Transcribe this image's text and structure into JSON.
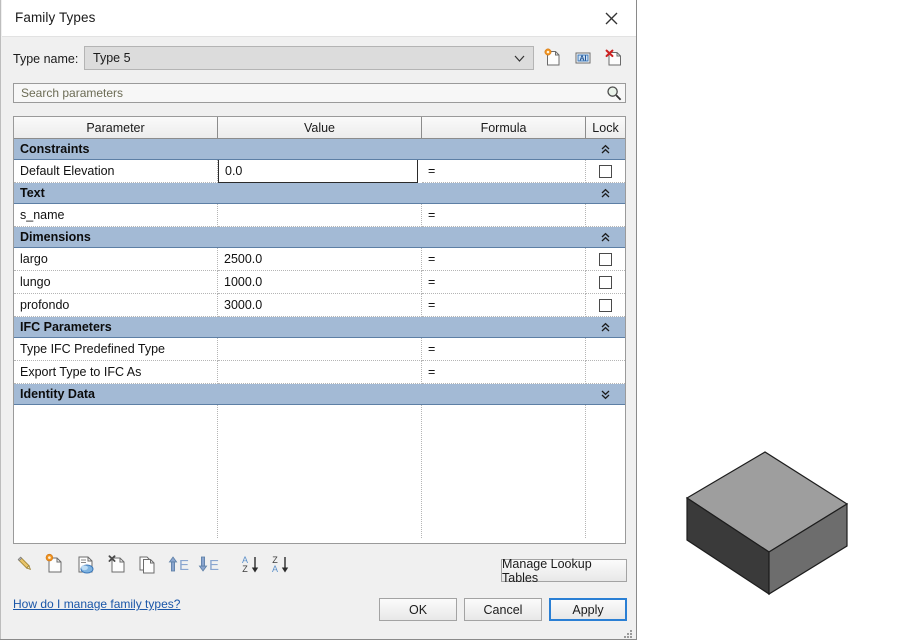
{
  "window": {
    "title": "Family Types",
    "close_icon": "close-icon"
  },
  "type_name": {
    "label": "Type name:",
    "value": "Type 5",
    "dropdown_icon": "chevron-down-icon",
    "buttons": [
      {
        "name": "new-type-icon",
        "tooltip": "New Type"
      },
      {
        "name": "rename-type-icon",
        "tooltip": "Rename Type"
      },
      {
        "name": "delete-type-icon",
        "tooltip": "Delete Type"
      }
    ]
  },
  "search": {
    "placeholder": "Search parameters",
    "value": "",
    "icon": "search-icon"
  },
  "grid": {
    "columns": [
      {
        "key": "parameter",
        "label": "Parameter"
      },
      {
        "key": "value",
        "label": "Value"
      },
      {
        "key": "formula",
        "label": "Formula"
      },
      {
        "key": "lock",
        "label": "Lock"
      }
    ],
    "groups": [
      {
        "label": "Constraints",
        "collapsed": false,
        "chevron": "chevron-up-icon",
        "rows": [
          {
            "parameter": "Default Elevation",
            "value": "0.0",
            "formula": "=",
            "lock": true,
            "editing": true
          }
        ]
      },
      {
        "label": "Text",
        "collapsed": false,
        "chevron": "chevron-up-icon",
        "rows": [
          {
            "parameter": "s_name",
            "value": "",
            "formula": "=",
            "lock": false,
            "editing": false
          }
        ]
      },
      {
        "label": "Dimensions",
        "collapsed": false,
        "chevron": "chevron-up-icon",
        "rows": [
          {
            "parameter": "largo",
            "value": "2500.0",
            "formula": "=",
            "lock": true,
            "editing": false
          },
          {
            "parameter": "lungo",
            "value": "1000.0",
            "formula": "=",
            "lock": true,
            "editing": false
          },
          {
            "parameter": "profondo",
            "value": "3000.0",
            "formula": "=",
            "lock": true,
            "editing": false
          }
        ]
      },
      {
        "label": "IFC Parameters",
        "collapsed": false,
        "chevron": "chevron-up-icon",
        "rows": [
          {
            "parameter": "Type IFC Predefined Type",
            "value": "",
            "formula": "=",
            "lock": false,
            "editing": false
          },
          {
            "parameter": "Export Type to IFC As",
            "value": "",
            "formula": "=",
            "lock": false,
            "editing": false
          }
        ]
      },
      {
        "label": "Identity Data",
        "collapsed": true,
        "chevron": "chevron-double-down-icon",
        "rows": []
      }
    ]
  },
  "toolbar": [
    {
      "name": "edit-parameter-icon",
      "tooltip": "Edit Parameter"
    },
    {
      "name": "new-parameter-icon",
      "tooltip": "New Parameter"
    },
    {
      "name": "shared-parameter-icon",
      "tooltip": "Add Shared Parameter"
    },
    {
      "name": "remove-parameter-icon",
      "tooltip": "Remove Parameter"
    },
    {
      "name": "duplicate-parameter-icon",
      "tooltip": "Duplicate Parameter"
    },
    {
      "name": "move-up-icon",
      "tooltip": "Move Parameter Up"
    },
    {
      "name": "move-down-icon",
      "tooltip": "Move Parameter Down"
    },
    {
      "name": "sort-ascending-icon",
      "tooltip": "Sort Ascending"
    },
    {
      "name": "sort-descending-icon",
      "tooltip": "Sort Descending"
    }
  ],
  "help_link": "How do I manage family types?",
  "buttons": {
    "lookup_tables": "Manage Lookup Tables",
    "ok": "OK",
    "cancel": "Cancel",
    "apply": "Apply"
  },
  "colors": {
    "group_header_bg": "#a3bad5",
    "accent_focus": "#2a7fd4",
    "link": "#1a56a8",
    "model_top_face": "#9e9e9e",
    "model_front_face": "#3c3c3c",
    "model_side_face": "#6e6e6e"
  },
  "viewport": {
    "model": "isometric-box-3d"
  }
}
